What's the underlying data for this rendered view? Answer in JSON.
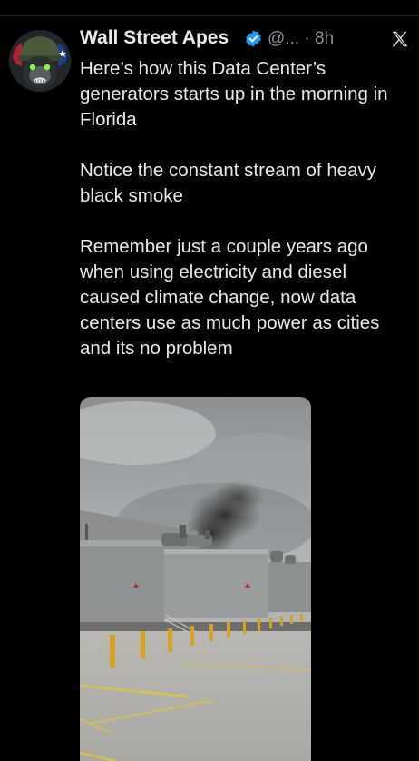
{
  "tweet": {
    "author_name": "Wall Street Apes",
    "handle_time": "@... · 8h",
    "verified": true,
    "paragraphs": [
      "Here’s how this Data Center’s generators starts up in the morning in Florida",
      "Notice the constant stream of heavy black smoke",
      "Remember just a couple years ago when using electricity and diesel caused climate change, now data centers use as much power as cities and its no problem"
    ]
  },
  "icons": {
    "verified": "verified-badge-icon",
    "close": "x-logo-icon",
    "avatar": "ape-helmet-avatar"
  },
  "colors": {
    "background": "#000000",
    "text": "#e7e9ea",
    "secondary": "#8b9095",
    "verified": "#1d9bf0",
    "bollard": "#d8a21a"
  }
}
